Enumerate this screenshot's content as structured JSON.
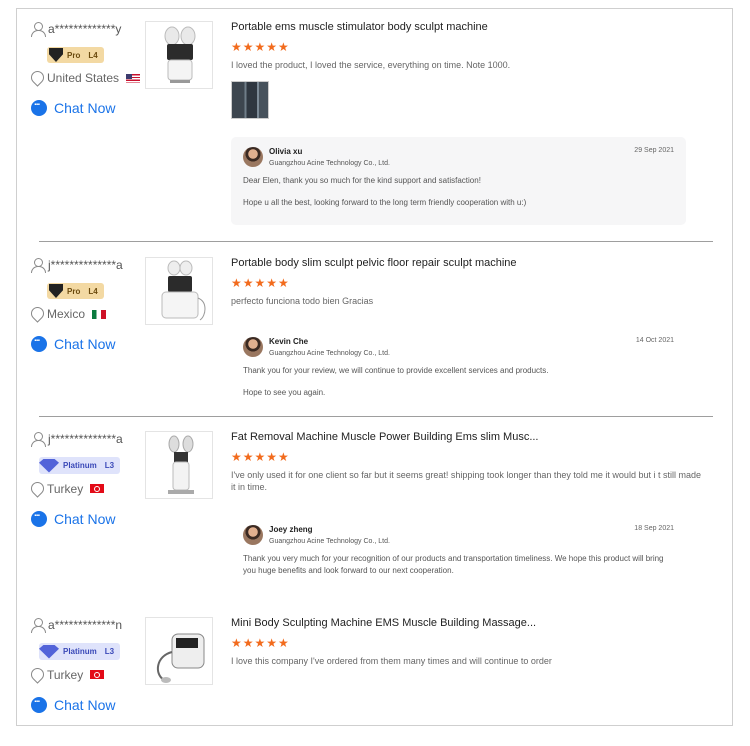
{
  "chat_label": "Chat Now",
  "colors": {
    "accent": "#1a73e8",
    "stars": "#f26b1d",
    "pro_badge": "#f3d9a3",
    "platinum_badge": "#dfe3fb"
  },
  "reviews": [
    {
      "buyer": "a*************y",
      "badge": {
        "type": "Pro",
        "level": "L4"
      },
      "country": "United States",
      "flag": "us",
      "product_title": "Portable ems muscle stimulator body sculpt machine",
      "stars": "★★★★★",
      "rating": 5,
      "text": "I loved the product, I loved the service, everything on time.  Note 1000.",
      "reply": {
        "name": "Olivia xu",
        "company": "Guangzhou Acine Technology Co., Ltd.",
        "date": "29 Sep 2021",
        "paragraphs": [
          "Dear Elen, thank you so much for the kind support and satisfaction!",
          "Hope u all the best, looking forward to the long term friendly cooperation with u:)"
        ]
      }
    },
    {
      "buyer": "j**************a",
      "badge": {
        "type": "Pro",
        "level": "L4"
      },
      "country": "Mexico",
      "flag": "mx",
      "product_title": "Portable body slim sculpt pelvic floor repair sculpt machine",
      "stars": "★★★★★",
      "rating": 5,
      "text": "perfecto funciona todo bien Gracias",
      "reply": {
        "name": "Kevin Che",
        "company": "Guangzhou Acine Technology Co., Ltd.",
        "date": "14 Oct 2021",
        "paragraphs": [
          "Thank you for your review, we will continue to provide excellent services and products.",
          "Hope to see you again."
        ]
      }
    },
    {
      "buyer": "j**************a",
      "badge": {
        "type": "Platinum",
        "level": "L3"
      },
      "country": "Turkey",
      "flag": "tr",
      "product_title": "Fat Removal Machine Muscle Power Building Ems slim Musc...",
      "stars": "★★★★★",
      "rating": 5,
      "text": "I've only used it for one client so far but it seems great! shipping took longer than they told me it would but i t still made it in time.",
      "reply": {
        "name": "Joey zheng",
        "company": "Guangzhou Acine Technology Co., Ltd.",
        "date": "18 Sep 2021",
        "paragraphs": [
          "Thank you very much for your recognition of our products and transportation timeliness. We hope this product will bring you huge benefits and look forward to our next cooperation."
        ]
      }
    },
    {
      "buyer": "a*************n",
      "badge": {
        "type": "Platinum",
        "level": "L3"
      },
      "country": "Turkey",
      "flag": "tr",
      "product_title": "Mini Body Sculpting Machine EMS Muscle Building Massage...",
      "stars": "★★★★★",
      "rating": 5,
      "text": "I love this company I've ordered from them many times and will continue to order"
    }
  ]
}
